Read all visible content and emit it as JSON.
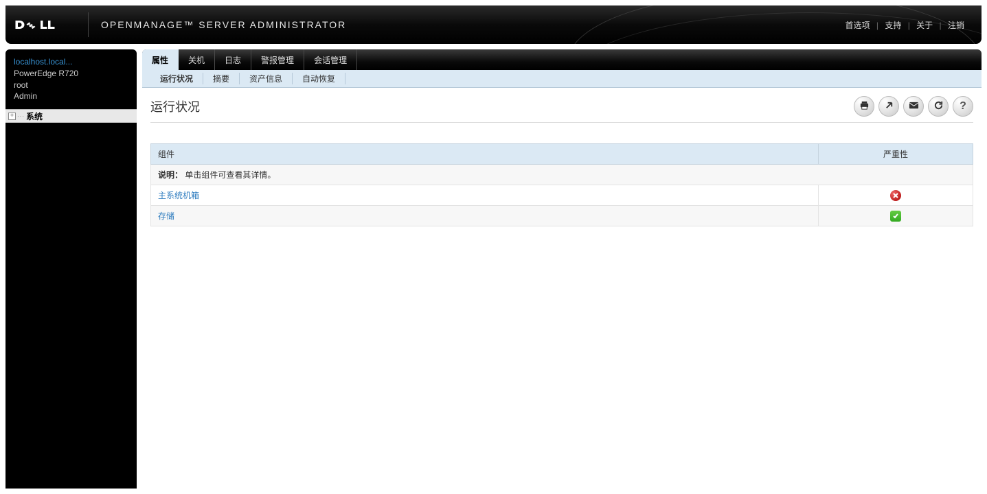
{
  "header": {
    "app_title": "OPENMANAGE™ SERVER ADMINISTRATOR",
    "links": {
      "preferences": "首选项",
      "support": "支持",
      "about": "关于",
      "logout": "注销"
    }
  },
  "sidebar": {
    "host": "localhost.local...",
    "model": "PowerEdge R720",
    "user": "root",
    "role": "Admin",
    "tree": {
      "root_label": "系统"
    }
  },
  "tabs": [
    {
      "id": "properties",
      "label": "属性",
      "active": true
    },
    {
      "id": "shutdown",
      "label": "关机",
      "active": false
    },
    {
      "id": "logs",
      "label": "日志",
      "active": false
    },
    {
      "id": "alerts",
      "label": "警报管理",
      "active": false
    },
    {
      "id": "session",
      "label": "会话管理",
      "active": false
    }
  ],
  "subtabs": [
    {
      "id": "health",
      "label": "运行状况",
      "active": true
    },
    {
      "id": "summary",
      "label": "摘要",
      "active": false
    },
    {
      "id": "asset",
      "label": "资产信息",
      "active": false
    },
    {
      "id": "autorecovery",
      "label": "自动恢复",
      "active": false
    }
  ],
  "page": {
    "title": "运行状况"
  },
  "toolbar": {
    "print": "print",
    "export": "export",
    "email": "email",
    "refresh": "refresh",
    "help": "help"
  },
  "table": {
    "columns": {
      "component": "组件",
      "severity": "严重性"
    },
    "description_label": "说明：",
    "description_text": "单击组件可查看其详情。",
    "rows": [
      {
        "label": "主系统机箱",
        "severity": "critical"
      },
      {
        "label": "存储",
        "severity": "ok"
      }
    ]
  }
}
